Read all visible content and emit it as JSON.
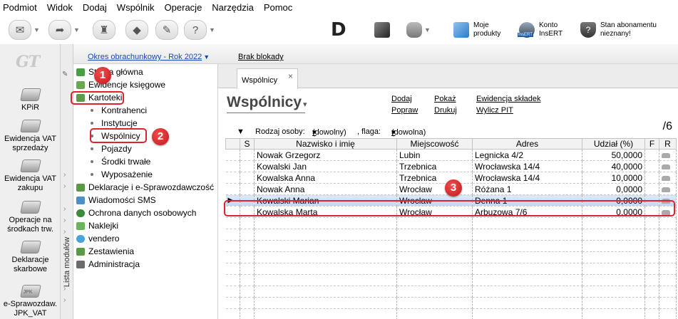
{
  "menu": [
    "Podmiot",
    "Widok",
    "Dodaj",
    "Wspólnik",
    "Operacje",
    "Narzędzia",
    "Pomoc"
  ],
  "toolbar": {
    "logo_letter": "D",
    "moje_produkty": [
      "Moje",
      "produkty"
    ],
    "konto": [
      "Konto",
      "InsERT"
    ],
    "konto_badge": "InsERT",
    "abonament": [
      "Stan abonamentu",
      "nieznany!"
    ]
  },
  "left_strip": {
    "logo": "GT",
    "items": [
      {
        "label": "KPiR",
        "icon": "kpir-icon"
      },
      {
        "label": "Ewidencja VAT sprzedaży",
        "icon": "vat-sales-icon"
      },
      {
        "label": "Ewidencja VAT zakupu",
        "icon": "vat-purchase-icon"
      },
      {
        "label": "Operacje na środkach trw.",
        "icon": "fixed-assets-icon"
      },
      {
        "label": "Deklaracje skarbowe",
        "icon": "tax-declaration-icon"
      },
      {
        "label": "e-Sprawozdaw. JPK_VAT",
        "icon": "jpk-icon",
        "badge": "JPK"
      }
    ]
  },
  "module_column": {
    "label": "Lista modułów"
  },
  "period_bar": {
    "period": "Okres obrachunkowy - Rok 2022",
    "block": "Brak blokady"
  },
  "nav_tree": [
    {
      "label": "Strona główna",
      "level": 0
    },
    {
      "label": "Ewidencje księgowe",
      "level": 0
    },
    {
      "label": "Kartoteki",
      "level": 0
    },
    {
      "label": "Kontrahenci",
      "level": 1
    },
    {
      "label": "Instytucje",
      "level": 1
    },
    {
      "label": "Wspólnicy",
      "level": 1
    },
    {
      "label": "Pojazdy",
      "level": 1
    },
    {
      "label": "Środki trwałe",
      "level": 1
    },
    {
      "label": "Wyposażenie",
      "level": 1
    },
    {
      "label": "Deklaracje i e-Sprawozdawczość",
      "level": 0
    },
    {
      "label": "Wiadomości SMS",
      "level": 0
    },
    {
      "label": "Ochrona danych osobowych",
      "level": 0
    },
    {
      "label": "Naklejki",
      "level": 0
    },
    {
      "label": "vendero",
      "level": 0
    },
    {
      "label": "Zestawienia",
      "level": 0
    },
    {
      "label": "Administracja",
      "level": 0
    }
  ],
  "main": {
    "tab": "Wspólnicy",
    "title": "Wspólnicy",
    "actions": {
      "dodaj": "Dodaj",
      "popraw": "Popraw",
      "pokaz": "Pokaż",
      "drukuj": "Drukuj",
      "ewidencja": "Ewidencja składek",
      "wylicz": "Wylicz PIT"
    },
    "filter": {
      "rodzaj_label": "Rodzaj osoby:",
      "rodzaj_value": "(dowolny)",
      "flaga_label": ", flaga:",
      "flaga_value": "(dowolna)"
    },
    "counter": "/6",
    "columns": [
      "S",
      "Nazwisko i imię",
      "Miejscowość",
      "Adres",
      "Udział (%)",
      "F",
      "R"
    ],
    "rows": [
      {
        "name": "Nowak Grzegorz",
        "city": "Lubin",
        "address": "Legnicka 4/2",
        "share": "50,0000"
      },
      {
        "name": "Kowalski Jan",
        "city": "Trzebnica",
        "address": "Wrocławska 14/4",
        "share": "40,0000"
      },
      {
        "name": "Kowalska Anna",
        "city": "Trzebnica",
        "address": "Wrocławska 14/4",
        "share": "10,0000"
      },
      {
        "name": "Nowak Anna",
        "city": "Wrocław",
        "address": "Różana 1",
        "share": "0,0000"
      },
      {
        "name": "Kowalski Marian",
        "city": "Wrocław",
        "address": "Denna 1",
        "share": "0,0000"
      },
      {
        "name": "Kowalska Marta",
        "city": "Wrocław",
        "address": "Arbuzowa 7/6",
        "share": "0,0000"
      }
    ],
    "selected_row": 4
  },
  "annotations": [
    "1",
    "2",
    "3"
  ],
  "colors": {
    "annotation_red": "#d9252b",
    "link_blue": "#1a47b8",
    "selection": "#c4d7ef"
  }
}
